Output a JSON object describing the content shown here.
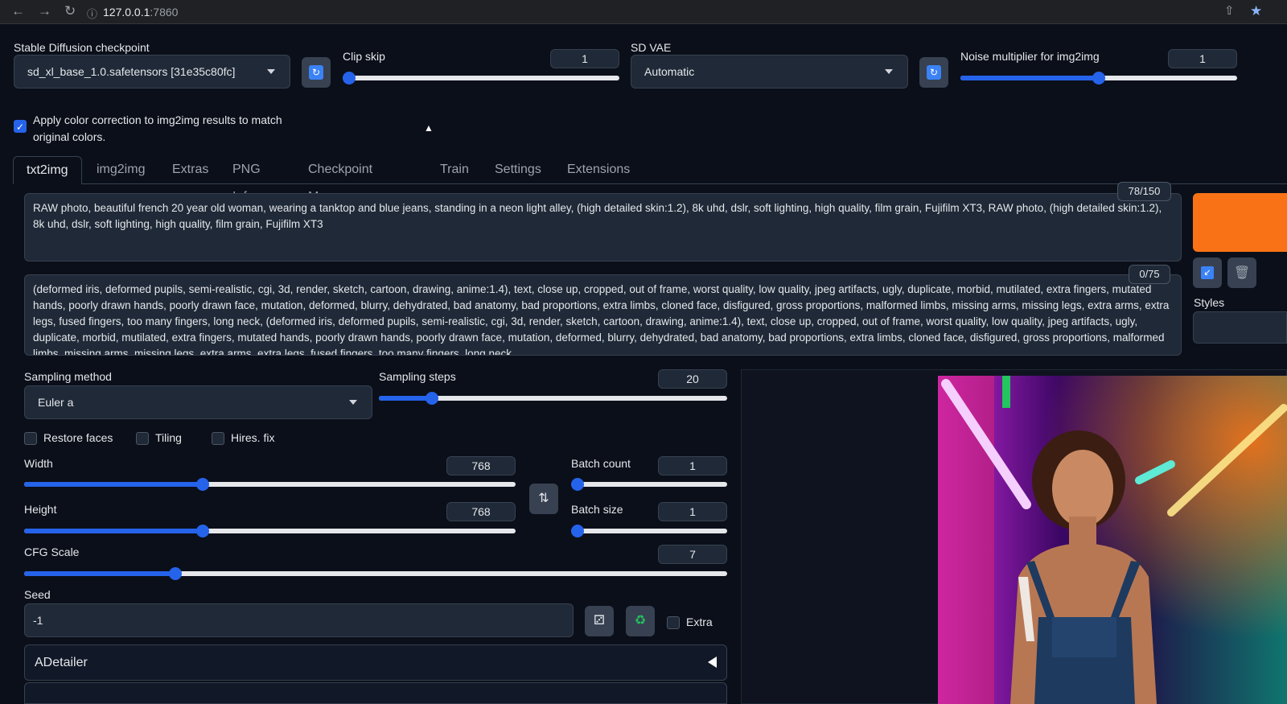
{
  "browser": {
    "url_host": "127.0.0.1",
    "url_port": ":7860"
  },
  "top": {
    "checkpoint_label": "Stable Diffusion checkpoint",
    "checkpoint_value": "sd_xl_base_1.0.safetensors [31e35c80fc]",
    "clip_skip_label": "Clip skip",
    "clip_skip_value": "1",
    "clip_skip_fraction": 0.0,
    "vae_label": "SD VAE",
    "vae_value": "Automatic",
    "noise_label": "Noise multiplier for img2img",
    "noise_value": "1",
    "noise_fraction": 0.5,
    "color_correction_line1": "Apply color correction to img2img results to match",
    "color_correction_line2": "original colors."
  },
  "tabs": [
    "txt2img",
    "img2img",
    "Extras",
    "PNG Info",
    "Checkpoint Merger",
    "Train",
    "Settings",
    "Extensions"
  ],
  "prompt": {
    "positive": "RAW photo, beautiful french 20 year old woman, wearing a tanktop and blue jeans, standing in a neon light alley, (high detailed skin:1.2), 8k uhd, dslr, soft lighting, high quality, film grain, Fujifilm XT3, RAW photo, (high detailed skin:1.2), 8k uhd, dslr, soft lighting, high quality, film grain, Fujifilm XT3",
    "positive_counter": "78/150",
    "negative": "(deformed iris, deformed pupils, semi-realistic, cgi, 3d, render, sketch, cartoon, drawing, anime:1.4), text, close up, cropped, out of frame, worst quality, low quality, jpeg artifacts, ugly, duplicate, morbid, mutilated, extra fingers, mutated hands, poorly drawn hands, poorly drawn face, mutation, deformed, blurry, dehydrated, bad anatomy, bad proportions, extra limbs, cloned face, disfigured, gross proportions, malformed limbs, missing arms, missing legs, extra arms, extra legs, fused fingers, too many fingers, long neck, (deformed iris, deformed pupils, semi-realistic, cgi, 3d, render, sketch, cartoon, drawing, anime:1.4), text, close up, cropped, out of frame, worst quality, low quality, jpeg artifacts, ugly, duplicate, morbid, mutilated, extra fingers, mutated hands, poorly drawn hands, poorly drawn face, mutation, deformed, blurry, dehydrated, bad anatomy, bad proportions, extra limbs, cloned face, disfigured, gross proportions, malformed limbs, missing arms, missing legs, extra arms, extra legs, fused fingers, too many fingers, long neck",
    "negative_counter": "0/75",
    "styles_label": "Styles"
  },
  "params": {
    "sampling_method_label": "Sampling method",
    "sampling_method_value": "Euler a",
    "sampling_steps_label": "Sampling steps",
    "sampling_steps_value": "20",
    "sampling_steps_fraction": 0.14,
    "restore_faces_label": "Restore faces",
    "tiling_label": "Tiling",
    "hires_fix_label": "Hires. fix",
    "width_label": "Width",
    "width_value": "768",
    "width_fraction": 0.36,
    "height_label": "Height",
    "height_value": "768",
    "height_fraction": 0.36,
    "batch_count_label": "Batch count",
    "batch_count_value": "1",
    "batch_count_fraction": 0.0,
    "batch_size_label": "Batch size",
    "batch_size_value": "1",
    "batch_size_fraction": 0.0,
    "cfg_label": "CFG Scale",
    "cfg_value": "7",
    "cfg_fraction": 0.21,
    "seed_label": "Seed",
    "seed_value": "-1",
    "extra_label": "Extra",
    "adetailer_label": "ADetailer"
  },
  "colors": {
    "background": "#0b0f19",
    "accent": "#2563eb",
    "generate": "#f97316"
  }
}
